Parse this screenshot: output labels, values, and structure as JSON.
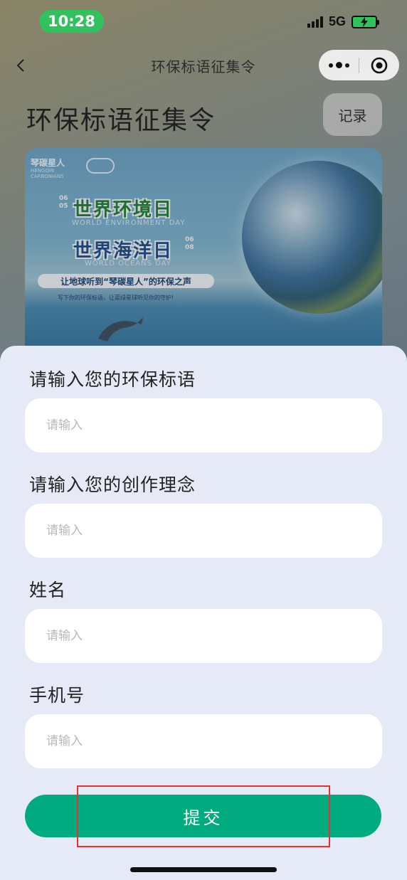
{
  "status_bar": {
    "time": "10:28",
    "network": "5G"
  },
  "nav": {
    "title": "环保标语征集令"
  },
  "header": {
    "title": "环保标语征集令",
    "record_label": "记录"
  },
  "banner": {
    "brand_name": "琴碳星人",
    "brand_sub": "HENGQIN CARBONIANS",
    "headline1": "世界环境日",
    "headline1_en": "WORLD ENVIRONMENT DAY",
    "date1": "06 05",
    "headline2": "世界海洋日",
    "headline2_en": "WORLD OCEANS DAY",
    "date2": "06 08",
    "tagline": "让地球听到“琴碳星人”的环保之声",
    "smalltext": "写下你的环保标语，让蓝绿星球听见你的守护!"
  },
  "form": {
    "slogan": {
      "label": "请输入您的环保标语",
      "placeholder": "请输入",
      "value": ""
    },
    "concept": {
      "label": "请输入您的创作理念",
      "placeholder": "请输入",
      "value": ""
    },
    "name": {
      "label": "姓名",
      "placeholder": "请输入",
      "value": ""
    },
    "phone": {
      "label": "手机号",
      "placeholder": "请输入",
      "value": ""
    },
    "submit_label": "提交"
  },
  "colors": {
    "submit": "#00ab7f",
    "time_pill": "#31c25d",
    "highlight": "#e8322c"
  }
}
